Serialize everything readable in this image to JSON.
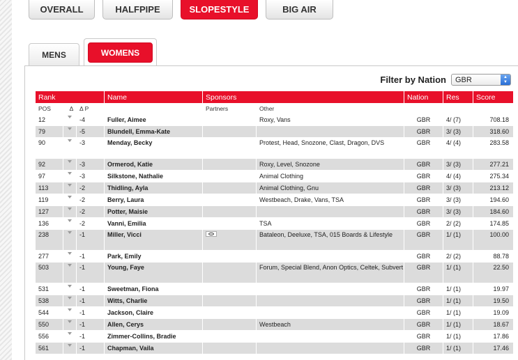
{
  "disciplines": [
    "OVERALL",
    "HALFPIPE",
    "SLOPESTYLE",
    "BIG AIR"
  ],
  "genders": [
    "MENS",
    "WOMENS"
  ],
  "filter": {
    "label": "Filter by Nation",
    "value": "GBR"
  },
  "headers": {
    "rank": "Rank",
    "name": "Name",
    "sponsors": "Sponsors",
    "nation": "Nation",
    "res": "Res",
    "score": "Score"
  },
  "subheaders": {
    "pos": "POS",
    "delta": "Δ",
    "delta_p": "Δ P",
    "partners": "Partners",
    "other": "Other"
  },
  "rows": [
    {
      "pos": "12",
      "dp": "-4",
      "name": "Fuller, Aimee",
      "other": "Roxy, Vans",
      "nation": "GBR",
      "res": "4/ (7)",
      "score": "708.18"
    },
    {
      "pos": "79",
      "dp": "-5",
      "name": "Blundell, Emma-Kate",
      "other": "",
      "nation": "GBR",
      "res": "3/ (3)",
      "score": "318.60"
    },
    {
      "pos": "90",
      "dp": "-3",
      "name": "Menday, Becky",
      "other": "Protest, Head, Snozone, Clast, Dragon, DVS",
      "nation": "GBR",
      "res": "4/ (4)",
      "score": "283.58"
    },
    {
      "pos": "92",
      "dp": "-3",
      "name": "Ormerod, Katie",
      "other": "Roxy, Level, Snozone",
      "nation": "GBR",
      "res": "3/ (3)",
      "score": "277.21"
    },
    {
      "pos": "97",
      "dp": "-3",
      "name": "Silkstone, Nathalie",
      "other": "Animal Clothing",
      "nation": "GBR",
      "res": "4/ (4)",
      "score": "275.34"
    },
    {
      "pos": "113",
      "dp": "-2",
      "name": "Thidling, Ayla",
      "other": "Animal Clothing, Gnu",
      "nation": "GBR",
      "res": "3/ (3)",
      "score": "213.12"
    },
    {
      "pos": "119",
      "dp": "-2",
      "name": "Berry, Laura",
      "other": "Westbeach, Drake, Vans, TSA",
      "nation": "GBR",
      "res": "3/ (3)",
      "score": "194.60"
    },
    {
      "pos": "127",
      "dp": "-2",
      "name": "Potter, Maisie",
      "other": "",
      "nation": "GBR",
      "res": "3/ (3)",
      "score": "184.60"
    },
    {
      "pos": "136",
      "dp": "-2",
      "name": "Vanni, Emilia",
      "other": "TSA",
      "nation": "GBR",
      "res": "2/ (2)",
      "score": "174.85"
    },
    {
      "pos": "238",
      "dp": "-1",
      "name": "Miller, Vicci",
      "partner_logo": "oakley-logo",
      "other": "Bataleon, Deeluxe, TSA, 015 Boards & Lifestyle",
      "nation": "GBR",
      "res": "1/ (1)",
      "score": "100.00"
    },
    {
      "pos": "277",
      "dp": "-1",
      "name": "Park, Emily",
      "other": "",
      "nation": "GBR",
      "res": "2/ (2)",
      "score": "88.78"
    },
    {
      "pos": "503",
      "dp": "-1",
      "name": "Young, Faye",
      "other": "Forum, Special Blend, Anon Optics, Celtek, Subvert",
      "nation": "GBR",
      "res": "1/ (1)",
      "score": "22.50"
    },
    {
      "pos": "531",
      "dp": "-1",
      "name": "Sweetman, Fiona",
      "other": "",
      "nation": "GBR",
      "res": "1/ (1)",
      "score": "19.97"
    },
    {
      "pos": "538",
      "dp": "-1",
      "name": "Witts, Charlie",
      "other": "",
      "nation": "GBR",
      "res": "1/ (1)",
      "score": "19.50"
    },
    {
      "pos": "544",
      "dp": "-1",
      "name": "Jackson, Claire",
      "other": "",
      "nation": "GBR",
      "res": "1/ (1)",
      "score": "19.09"
    },
    {
      "pos": "550",
      "dp": "-1",
      "name": "Allen, Cerys",
      "other": "Westbeach",
      "nation": "GBR",
      "res": "1/ (1)",
      "score": "18.67"
    },
    {
      "pos": "556",
      "dp": "-1",
      "name": "Zimmer-Collins, Bradie",
      "other": "",
      "nation": "GBR",
      "res": "1/ (1)",
      "score": "17.86"
    },
    {
      "pos": "561",
      "dp": "-1",
      "name": "Chapman, Vaila",
      "other": "",
      "nation": "GBR",
      "res": "1/ (1)",
      "score": "17.46"
    }
  ],
  "colors": {
    "accent": "#e8102a",
    "row_alt": "#dcdcdc"
  }
}
